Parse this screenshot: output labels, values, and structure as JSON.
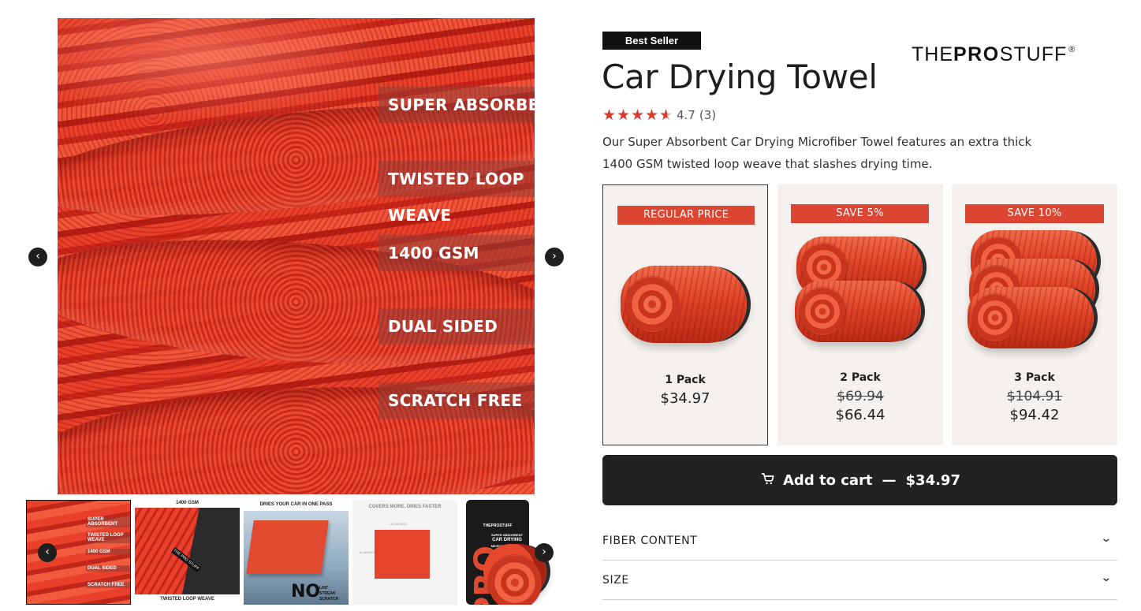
{
  "gallery": {
    "features": [
      "SUPER ABSORBENT",
      "TWISTED LOOP WEAVE",
      "1400 GSM",
      "DUAL SIDED",
      "SCRATCH FREE"
    ],
    "prev_icon": "chevron-left-icon",
    "next_icon": "chevron-right-icon",
    "thumbs": [
      {
        "labels": [
          "SUPER ABSORBENT",
          "TWISTED LOOP WEAVE",
          "1400 GSM",
          "DUAL SIDED",
          "SCRATCH FREE"
        ]
      },
      {
        "top": "1400 GSM",
        "bottom": "TWISTED LOOP WEAVE",
        "tag": "THE PRO STUFF"
      },
      {
        "top": "DRIES YOUR CAR IN ONE PASS",
        "no": "NO",
        "small": [
          "LINT",
          "STREAK",
          "SCRATCH"
        ]
      },
      {
        "top": "COVERS MORE, DRIES FASTER",
        "dim_w": "24 INCHES",
        "dim_h": "16 INCHES"
      },
      {
        "brand": "THEPROSTUFF",
        "line1": "SUPER ABSORBENT",
        "line2": "CAR DRYING",
        "line3": "MICROFIBER TOWEL",
        "pro": "PRO"
      }
    ]
  },
  "product": {
    "badge": "Best Seller",
    "brand_pre": "THE",
    "brand_mid": "PRO",
    "brand_post": "STUFF",
    "brand_reg": "®",
    "title": "Car Drying Towel",
    "rating": "4.7",
    "rating_count": "(3)",
    "description": "Our Super Absorbent Car Drying Microfiber Towel features an extra thick 1400 GSM twisted loop weave that slashes drying time."
  },
  "packs": [
    {
      "banner": "REGULAR PRICE",
      "name": "1 Pack",
      "old_price": "",
      "price": "$34.97",
      "selected": true
    },
    {
      "banner": "SAVE 5%",
      "name": "2 Pack",
      "old_price": "$69.94",
      "price": "$66.44",
      "selected": false
    },
    {
      "banner": "SAVE 10%",
      "name": "3 Pack",
      "old_price": "$104.91",
      "price": "$94.42",
      "selected": false
    }
  ],
  "cart": {
    "label": "Add to cart",
    "separator": "—",
    "price": "$34.97",
    "icon": "cart-icon"
  },
  "accordion": [
    {
      "label": "FIBER CONTENT"
    },
    {
      "label": "SIZE"
    }
  ],
  "colors": {
    "accent": "#dc4532",
    "badge_bg": "#111111",
    "button_bg": "#222222",
    "card_bg": "#f4f1ee"
  }
}
